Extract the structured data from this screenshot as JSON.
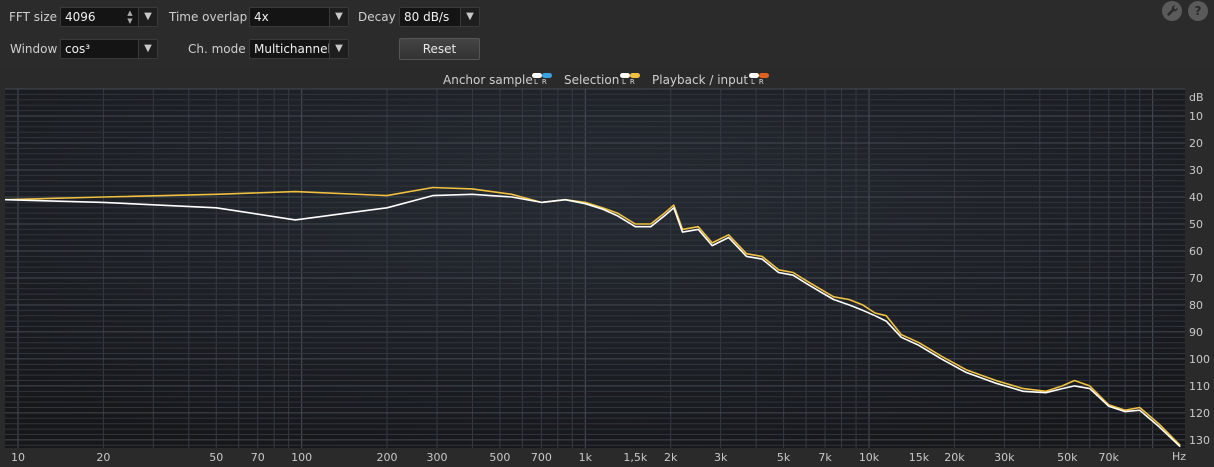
{
  "toolbar": {
    "fft_size": {
      "label": "FFT size",
      "value": "4096"
    },
    "time_overlap": {
      "label": "Time overlap",
      "value": "4x"
    },
    "decay": {
      "label": "Decay",
      "value": "80 dB/s"
    },
    "window": {
      "label": "Window",
      "value": "cos³"
    },
    "ch_mode": {
      "label": "Ch. mode",
      "value": "Multichannel"
    },
    "reset_label": "Reset",
    "help_label": "?"
  },
  "legend": {
    "anchor": "Anchor sample",
    "selection": "Selection",
    "playback": "Playback / input",
    "lr": "LR"
  },
  "colors": {
    "background": "#2a2a2a",
    "plot_bg": "#1c1f24",
    "anchor_l": "#ffffff",
    "anchor_r": "#3aa0e0",
    "selection_l": "#ffffff",
    "selection_r": "#f0c040",
    "playback_l": "#ffffff",
    "playback_r": "#e06020",
    "series_white": "#ffffff",
    "series_yellow": "#f0c040"
  },
  "chart_data": {
    "type": "line",
    "xscale": "log",
    "xlim": [
      9,
      130000
    ],
    "ylim": [
      -133,
      0
    ],
    "y_unit": "dB",
    "x_unit": "Hz",
    "y_ticks": [
      -10,
      -20,
      -30,
      -40,
      -50,
      -60,
      -70,
      -80,
      -90,
      -100,
      -110,
      -120,
      -130
    ],
    "x_tick_labels": [
      {
        "v": 10,
        "t": "10"
      },
      {
        "v": 20,
        "t": "20"
      },
      {
        "v": 50,
        "t": "50"
      },
      {
        "v": 70,
        "t": "70"
      },
      {
        "v": 100,
        "t": "100"
      },
      {
        "v": 200,
        "t": "200"
      },
      {
        "v": 300,
        "t": "300"
      },
      {
        "v": 500,
        "t": "500"
      },
      {
        "v": 700,
        "t": "700"
      },
      {
        "v": 1000,
        "t": "1k"
      },
      {
        "v": 1500,
        "t": "1,5k"
      },
      {
        "v": 2000,
        "t": "2k"
      },
      {
        "v": 3000,
        "t": "3k"
      },
      {
        "v": 5000,
        "t": "5k"
      },
      {
        "v": 7000,
        "t": "7k"
      },
      {
        "v": 10000,
        "t": "10k"
      },
      {
        "v": 15000,
        "t": "15k"
      },
      {
        "v": 20000,
        "t": "20k"
      },
      {
        "v": 30000,
        "t": "30k"
      },
      {
        "v": 50000,
        "t": "50k"
      },
      {
        "v": 70000,
        "t": "70k"
      }
    ],
    "grid": true,
    "series": [
      {
        "color": "#f0c040",
        "x": [
          9,
          20,
          50,
          95,
          200,
          290,
          400,
          550,
          700,
          850,
          1000,
          1150,
          1300,
          1500,
          1700,
          1900,
          2050,
          2200,
          2500,
          2800,
          3200,
          3700,
          4200,
          4800,
          5400,
          6000,
          6700,
          7500,
          8500,
          9500,
          10500,
          11500,
          13000,
          15000,
          18000,
          22000,
          28000,
          35000,
          42000,
          48000,
          53000,
          60000,
          70000,
          80000,
          90000,
          105000,
          125000
        ],
        "y": [
          -41,
          -40,
          -39,
          -38,
          -39.5,
          -36.5,
          -37,
          -39,
          -42,
          -41,
          -42,
          -44,
          -46,
          -50,
          -50,
          -46,
          -43,
          -52,
          -51,
          -57,
          -54,
          -61,
          -62,
          -67,
          -68,
          -71,
          -74,
          -77,
          -78,
          -80,
          -83,
          -84,
          -91,
          -94,
          -99,
          -104,
          -108,
          -111,
          -112,
          -110,
          -108,
          -110,
          -117,
          -119,
          -118,
          -124,
          -132
        ]
      },
      {
        "color": "#ffffff",
        "x": [
          9,
          20,
          50,
          95,
          200,
          290,
          400,
          550,
          700,
          850,
          1000,
          1150,
          1300,
          1500,
          1700,
          1900,
          2050,
          2200,
          2500,
          2800,
          3200,
          3700,
          4200,
          4800,
          5400,
          6000,
          6700,
          7500,
          8500,
          9500,
          10500,
          11500,
          13000,
          15000,
          18000,
          22000,
          28000,
          35000,
          42000,
          48000,
          53000,
          60000,
          70000,
          80000,
          90000,
          105000,
          125000
        ],
        "y": [
          -41,
          -42,
          -44,
          -48.5,
          -44,
          -39.5,
          -39,
          -40,
          -42,
          -41,
          -42.5,
          -44.5,
          -47,
          -51,
          -51,
          -47,
          -44,
          -53,
          -52,
          -58,
          -55,
          -62,
          -63,
          -68,
          -69,
          -72,
          -75,
          -78,
          -80,
          -82,
          -84,
          -86,
          -92,
          -95,
          -100,
          -105,
          -109,
          -112,
          -112.5,
          -111,
          -110,
          -111,
          -117.5,
          -119.5,
          -119,
          -125,
          -132.5
        ]
      }
    ]
  }
}
